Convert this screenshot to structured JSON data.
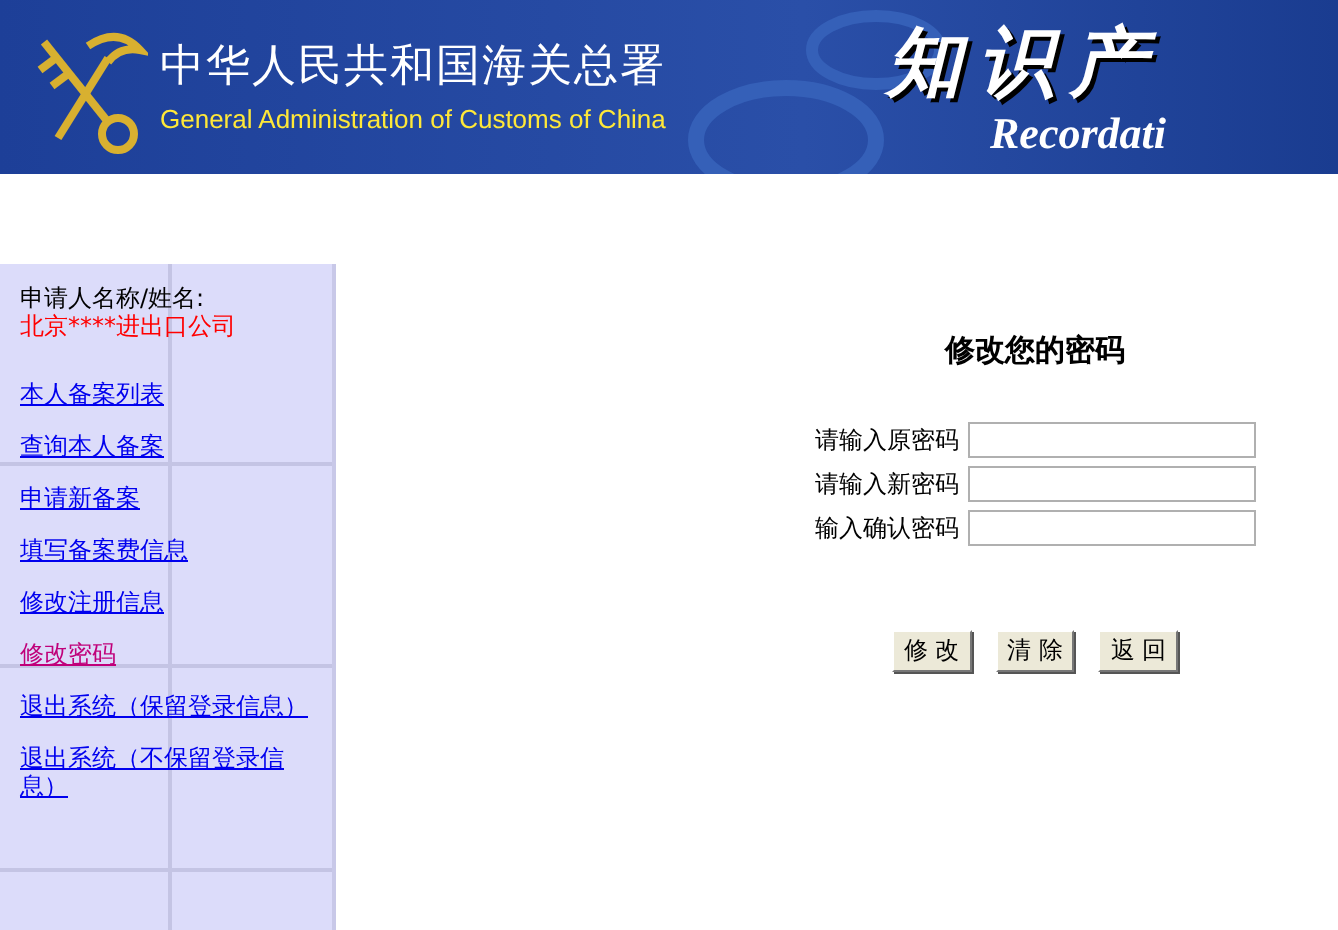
{
  "header": {
    "title_cn": "中华人民共和国海关总署",
    "title_en": "General Administration of Customs of China",
    "banner_cn": "知识产",
    "banner_en": "Recordati"
  },
  "sidebar": {
    "applicant_label": "申请人名称/姓名:",
    "applicant_name": "北京****进出口公司",
    "items": [
      {
        "label": "本人备案列表",
        "selected": false
      },
      {
        "label": "查询本人备案",
        "selected": false
      },
      {
        "label": "申请新备案",
        "selected": false
      },
      {
        "label": "填写备案费信息",
        "selected": false
      },
      {
        "label": "修改注册信息",
        "selected": false
      },
      {
        "label": "修改密码",
        "selected": true
      },
      {
        "label": "退出系统（保留登录信息）",
        "selected": false
      },
      {
        "label": "退出系统（不保留登录信息）",
        "selected": false
      }
    ]
  },
  "form": {
    "title": "修改您的密码",
    "fields": [
      {
        "label": "请输入原密码"
      },
      {
        "label": "请输入新密码"
      },
      {
        "label": "输入确认密码"
      }
    ],
    "buttons": [
      "修 改",
      "清 除",
      "返 回"
    ]
  }
}
